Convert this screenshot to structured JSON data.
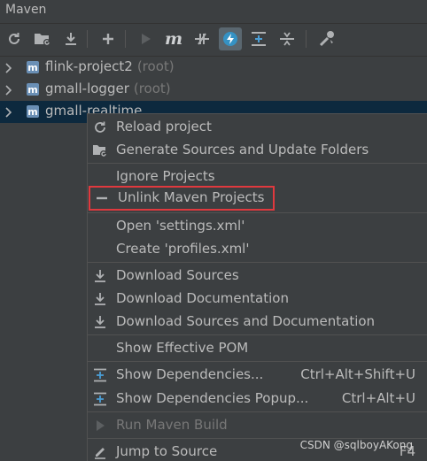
{
  "window": {
    "title": "Maven"
  },
  "toolbar": {
    "buttons": [
      {
        "icon": "reload-icon"
      },
      {
        "icon": "generate-sources-icon"
      },
      {
        "icon": "download-icon"
      },
      {
        "icon": "add-icon"
      },
      {
        "icon": "run-icon"
      },
      {
        "icon": "maven-goal-icon"
      },
      {
        "icon": "toggle-offline-icon"
      },
      {
        "icon": "skip-tests-icon"
      },
      {
        "icon": "show-dependencies-icon"
      },
      {
        "icon": "collapse-all-icon"
      },
      {
        "icon": "settings-wrench-icon"
      }
    ]
  },
  "tree": {
    "projects": [
      {
        "name": "flink-project2",
        "suffix": "(root)"
      },
      {
        "name": "gmall-logger",
        "suffix": "(root)"
      },
      {
        "name": "gmall-realtime",
        "suffix": ""
      }
    ]
  },
  "context_menu": {
    "items": {
      "reload": "Reload project",
      "generate": "Generate Sources and Update Folders",
      "ignore": "Ignore Projects",
      "unlink": "Unlink Maven Projects",
      "open_settings": "Open 'settings.xml'",
      "create_profiles": "Create 'profiles.xml'",
      "download_sources": "Download Sources",
      "download_docs": "Download Documentation",
      "download_both": "Download Sources and Documentation",
      "effective_pom": "Show Effective POM",
      "show_deps": "Show Dependencies...",
      "show_deps_shortcut": "Ctrl+Alt+Shift+U",
      "show_deps_popup": "Show Dependencies Popup...",
      "show_deps_popup_shortcut": "Ctrl+Alt+U",
      "run_build": "Run Maven Build",
      "jump_source": "Jump to Source",
      "jump_source_shortcut": "F4"
    }
  },
  "watermark": "CSDN @sqlboyAKong",
  "colors": {
    "background": "#3c3f41",
    "selection": "#0d293e",
    "highlight_box": "#e0393e",
    "active_toggle": "#3592c4"
  }
}
